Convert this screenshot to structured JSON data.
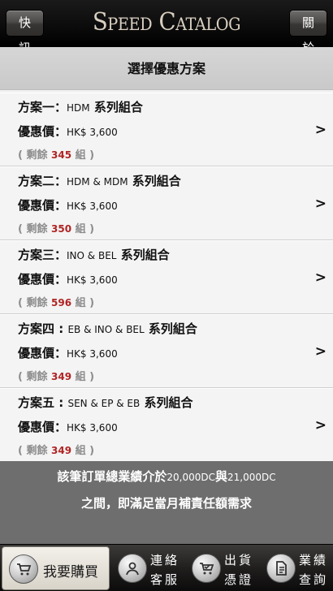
{
  "header": {
    "left_button": "快訊",
    "logo_text": "Speed Catalog",
    "right_button": "關於"
  },
  "section_title": "選擇優惠方案",
  "plans": [
    {
      "label": "方案一：",
      "series": "HDM",
      "suffix": " 系列組合",
      "price_label": "優惠價：",
      "price": "HK$ 3,600",
      "remain_prefix": "( 剩餘 ",
      "remain_count": "345",
      "remain_suffix": " 組 )"
    },
    {
      "label": "方案二：",
      "series": "HDM & MDM",
      "suffix": " 系列組合",
      "price_label": "優惠價：",
      "price": "HK$ 3,600",
      "remain_prefix": "( 剩餘 ",
      "remain_count": "350",
      "remain_suffix": " 組 )"
    },
    {
      "label": "方案三：",
      "series": "INO & BEL",
      "suffix": " 系列組合",
      "price_label": "優惠價：",
      "price": "HK$ 3,600",
      "remain_prefix": "( 剩餘 ",
      "remain_count": "596",
      "remain_suffix": " 組 )"
    },
    {
      "label": "方案四 : ",
      "series": "EB & INO & BEL",
      "suffix": " 系列組合",
      "price_label": "優惠價：",
      "price": "HK$ 3,600",
      "remain_prefix": "( 剩餘 ",
      "remain_count": "349",
      "remain_suffix": " 組 )"
    },
    {
      "label": "方案五 : ",
      "series": "SEN & EP & EB",
      "suffix": " 系列組合",
      "price_label": "優惠價：",
      "price": "HK$ 3,600",
      "remain_prefix": "( 剩餘 ",
      "remain_count": "349",
      "remain_suffix": " 組 )"
    }
  ],
  "arrow": ">",
  "note": {
    "line1_a": "該筆訂單總業績介於",
    "line1_b": "20,000DC",
    "line1_c": "與",
    "line1_d": "21,000DC",
    "line2": "之間，即滿足當月補責任額需求"
  },
  "tabs": [
    {
      "label": "我要購買",
      "icon": "cart-icon"
    },
    {
      "label_1": "連絡",
      "label_2": "客服",
      "icon": "person-icon"
    },
    {
      "label_1": "出貨",
      "label_2": "憑證",
      "icon": "cart-check-icon"
    },
    {
      "label_1": "業績",
      "label_2": "查詢",
      "icon": "document-icon"
    }
  ]
}
